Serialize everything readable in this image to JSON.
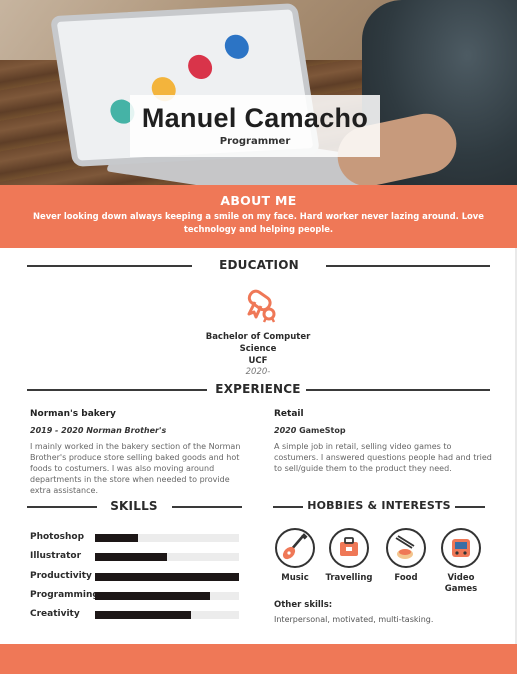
{
  "header": {
    "name": "Manuel Camacho",
    "title": "Programmer"
  },
  "about": {
    "heading": "ABOUT ME",
    "text": "Never looking down always keeping a smile on my face. Hard worker never lazing around. Love technology and helping people."
  },
  "education": {
    "heading": "EDUCATION",
    "icon": "diploma-icon",
    "degree_line1": "Bachelor of Computer",
    "degree_line2": "Science",
    "school": "UCF",
    "year": "2020-"
  },
  "experience": {
    "heading": "EXPERIENCE",
    "jobs": [
      {
        "title": "Norman's bakery",
        "dates": "2019 - 2020 Norman Brother's",
        "description": "I mainly worked in the bakery section of the Norman Brother's produce store selling baked goods and hot foods to costumers. I was also moving around departments in the store when needed to provide extra assistance."
      },
      {
        "title": "Retail",
        "dates": "2020",
        "company": "GameStop",
        "description": "A simple job in retail, selling video games to costumers. I answered questions people had and tried to sell/guide them  to the product they need."
      }
    ]
  },
  "skills": {
    "heading": "SKILLS",
    "items": [
      {
        "label": "Photoshop",
        "level": 0.3
      },
      {
        "label": "Illustrator",
        "level": 0.5
      },
      {
        "label": "Productivity",
        "level": 1.0
      },
      {
        "label": "Programming",
        "level": 0.8
      },
      {
        "label": "Creativity",
        "level": 0.67
      }
    ]
  },
  "hobbies": {
    "heading": "HOBBIES & INTERESTS",
    "items": [
      {
        "label": "Music",
        "icon": "guitar-icon"
      },
      {
        "label": "Travelling",
        "icon": "suitcase-icon"
      },
      {
        "label": "Food",
        "icon": "sushi-icon"
      },
      {
        "label": "Video Games",
        "icon": "game-console-icon"
      }
    ],
    "other_title": "Other skills:",
    "other_text": "Interpersonal, motivated, multi-tasking."
  },
  "colors": {
    "accent": "#ef7857",
    "dark": "#1d1717"
  }
}
